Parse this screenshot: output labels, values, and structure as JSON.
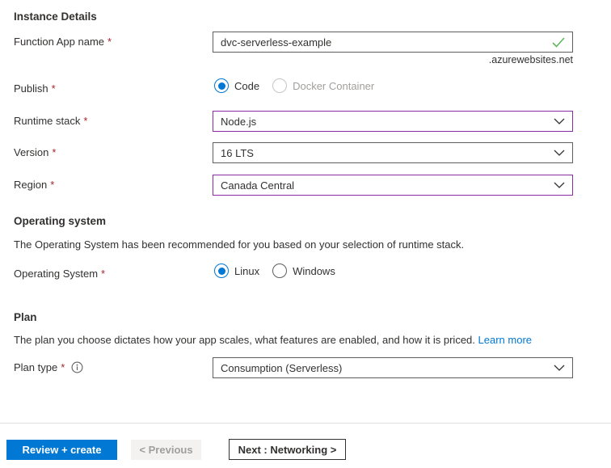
{
  "ui": {
    "required_marker": "*"
  },
  "colors": {
    "accent_blue": "#0078d4",
    "changed_field_border": "#8a2da5",
    "neutral_field_border": "#605e5c",
    "valid_green": "#5db85c",
    "required_red": "#a4262c",
    "text": "#323130",
    "disabled_text": "#a19f9d",
    "disabled_bg": "#f3f2f1",
    "divider": "#e1dfdd"
  },
  "sections": {
    "instance_details": {
      "heading": "Instance Details",
      "function_app_name": {
        "label": "Function App name",
        "value": "dvc-serverless-example",
        "suffix": ".azurewebsites.net"
      },
      "publish": {
        "label": "Publish",
        "options": [
          {
            "label": "Code",
            "selected": true
          },
          {
            "label": "Docker Container",
            "selected": false,
            "disabled": true
          }
        ]
      },
      "runtime_stack": {
        "label": "Runtime stack",
        "value": "Node.js"
      },
      "version": {
        "label": "Version",
        "value": "16 LTS"
      },
      "region": {
        "label": "Region",
        "value": "Canada Central"
      }
    },
    "operating_system": {
      "heading": "Operating system",
      "description": "The Operating System has been recommended for you based on your selection of runtime stack.",
      "field": {
        "label": "Operating System",
        "options": [
          {
            "label": "Linux",
            "selected": true
          },
          {
            "label": "Windows",
            "selected": false
          }
        ]
      }
    },
    "plan": {
      "heading": "Plan",
      "description": "The plan you choose dictates how your app scales, what features are enabled, and how it is priced.",
      "link_label": "Learn more",
      "plan_type": {
        "label": "Plan type",
        "value": "Consumption (Serverless)"
      }
    }
  },
  "footer": {
    "review_create_label": "Review + create",
    "previous_label": "< Previous",
    "next_label": "Next : Networking >"
  }
}
